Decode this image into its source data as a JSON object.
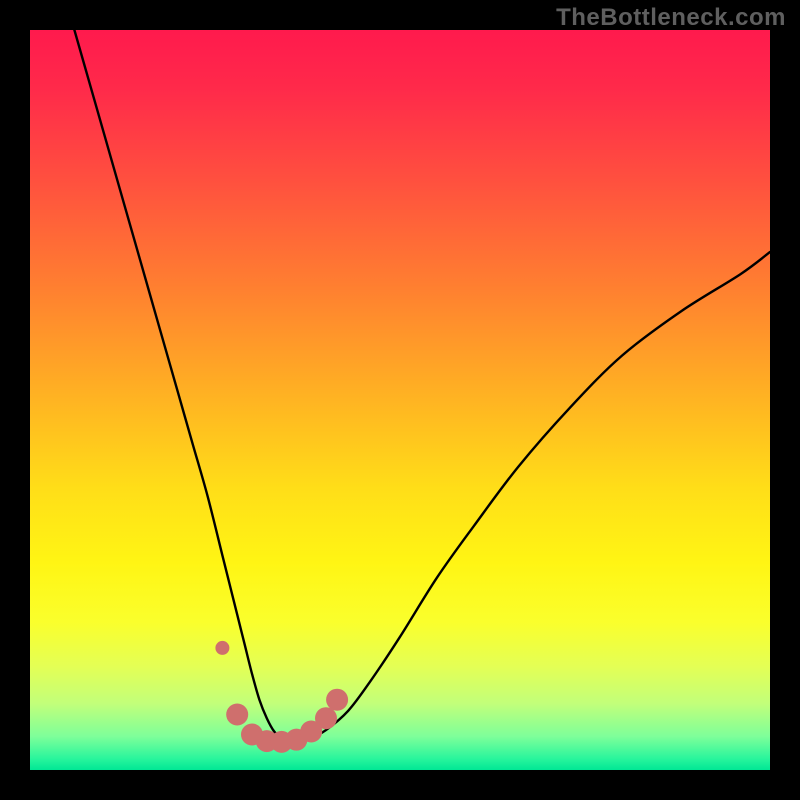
{
  "watermark": {
    "text": "TheBottleneck.com"
  },
  "chart_data": {
    "type": "line",
    "title": "",
    "xlabel": "",
    "ylabel": "",
    "xlim": [
      0,
      100
    ],
    "ylim": [
      0,
      100
    ],
    "gradient_stops": [
      {
        "offset": 0.0,
        "color": "#ff1a4d"
      },
      {
        "offset": 0.08,
        "color": "#ff2a4a"
      },
      {
        "offset": 0.2,
        "color": "#ff4f3f"
      },
      {
        "offset": 0.35,
        "color": "#ff8030"
      },
      {
        "offset": 0.5,
        "color": "#ffb422"
      },
      {
        "offset": 0.62,
        "color": "#ffde18"
      },
      {
        "offset": 0.72,
        "color": "#fff514"
      },
      {
        "offset": 0.8,
        "color": "#faff2c"
      },
      {
        "offset": 0.86,
        "color": "#e4ff55"
      },
      {
        "offset": 0.91,
        "color": "#c2ff7a"
      },
      {
        "offset": 0.955,
        "color": "#7dff9a"
      },
      {
        "offset": 0.985,
        "color": "#28f59c"
      },
      {
        "offset": 1.0,
        "color": "#00e795"
      }
    ],
    "series": [
      {
        "name": "bottleneck-curve",
        "x": [
          6,
          8,
          10,
          12,
          14,
          16,
          18,
          20,
          22,
          24,
          26,
          27,
          28,
          29,
          30,
          31,
          32,
          33,
          34,
          35,
          36,
          38,
          40,
          43,
          46,
          50,
          55,
          60,
          66,
          73,
          80,
          88,
          96,
          100
        ],
        "y": [
          100,
          93,
          86,
          79,
          72,
          65,
          58,
          51,
          44,
          37,
          29,
          25,
          21,
          17,
          13,
          9.5,
          7,
          5.2,
          4.3,
          4.1,
          4.1,
          4.4,
          5.4,
          8,
          12,
          18,
          26,
          33,
          41,
          49,
          56,
          62,
          67,
          70
        ]
      }
    ],
    "dots": {
      "color": "#cf6f6d",
      "radius_large": 11,
      "radius_small": 7,
      "points": [
        {
          "x": 26.0,
          "y": 16.5,
          "r": "small"
        },
        {
          "x": 28.0,
          "y": 7.5,
          "r": "large"
        },
        {
          "x": 30.0,
          "y": 4.8,
          "r": "large"
        },
        {
          "x": 32.0,
          "y": 3.9,
          "r": "large"
        },
        {
          "x": 34.0,
          "y": 3.8,
          "r": "large"
        },
        {
          "x": 36.0,
          "y": 4.1,
          "r": "large"
        },
        {
          "x": 38.0,
          "y": 5.2,
          "r": "large"
        },
        {
          "x": 40.0,
          "y": 7.0,
          "r": "large"
        },
        {
          "x": 41.5,
          "y": 9.5,
          "r": "large"
        }
      ]
    }
  }
}
